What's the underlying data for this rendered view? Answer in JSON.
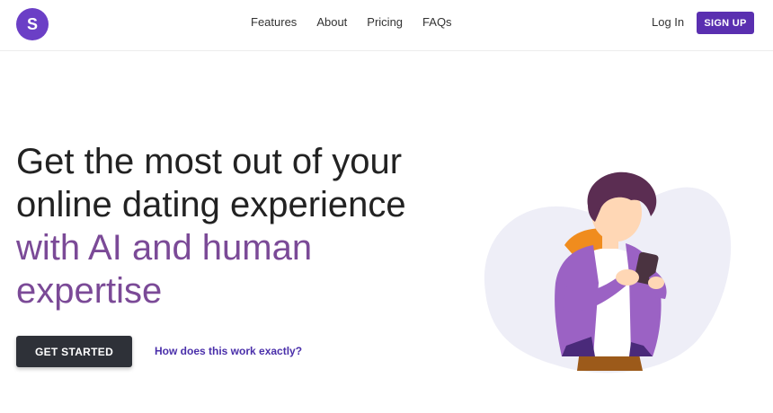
{
  "brand": {
    "logo_letter": "S",
    "color": "#6b3fc6"
  },
  "nav": {
    "links": [
      "Features",
      "About",
      "Pricing",
      "FAQs"
    ],
    "login": "Log In",
    "signup": "SIGN UP"
  },
  "hero": {
    "title_part1": "Get the most out of your online dating experience ",
    "title_accent": "with AI and human expertise",
    "accent_color": "#7b4a97",
    "cta": "GET STARTED",
    "secondary_link": "How does this work exactly?"
  },
  "illustration": {
    "icon": "person-with-phone-illustration"
  }
}
